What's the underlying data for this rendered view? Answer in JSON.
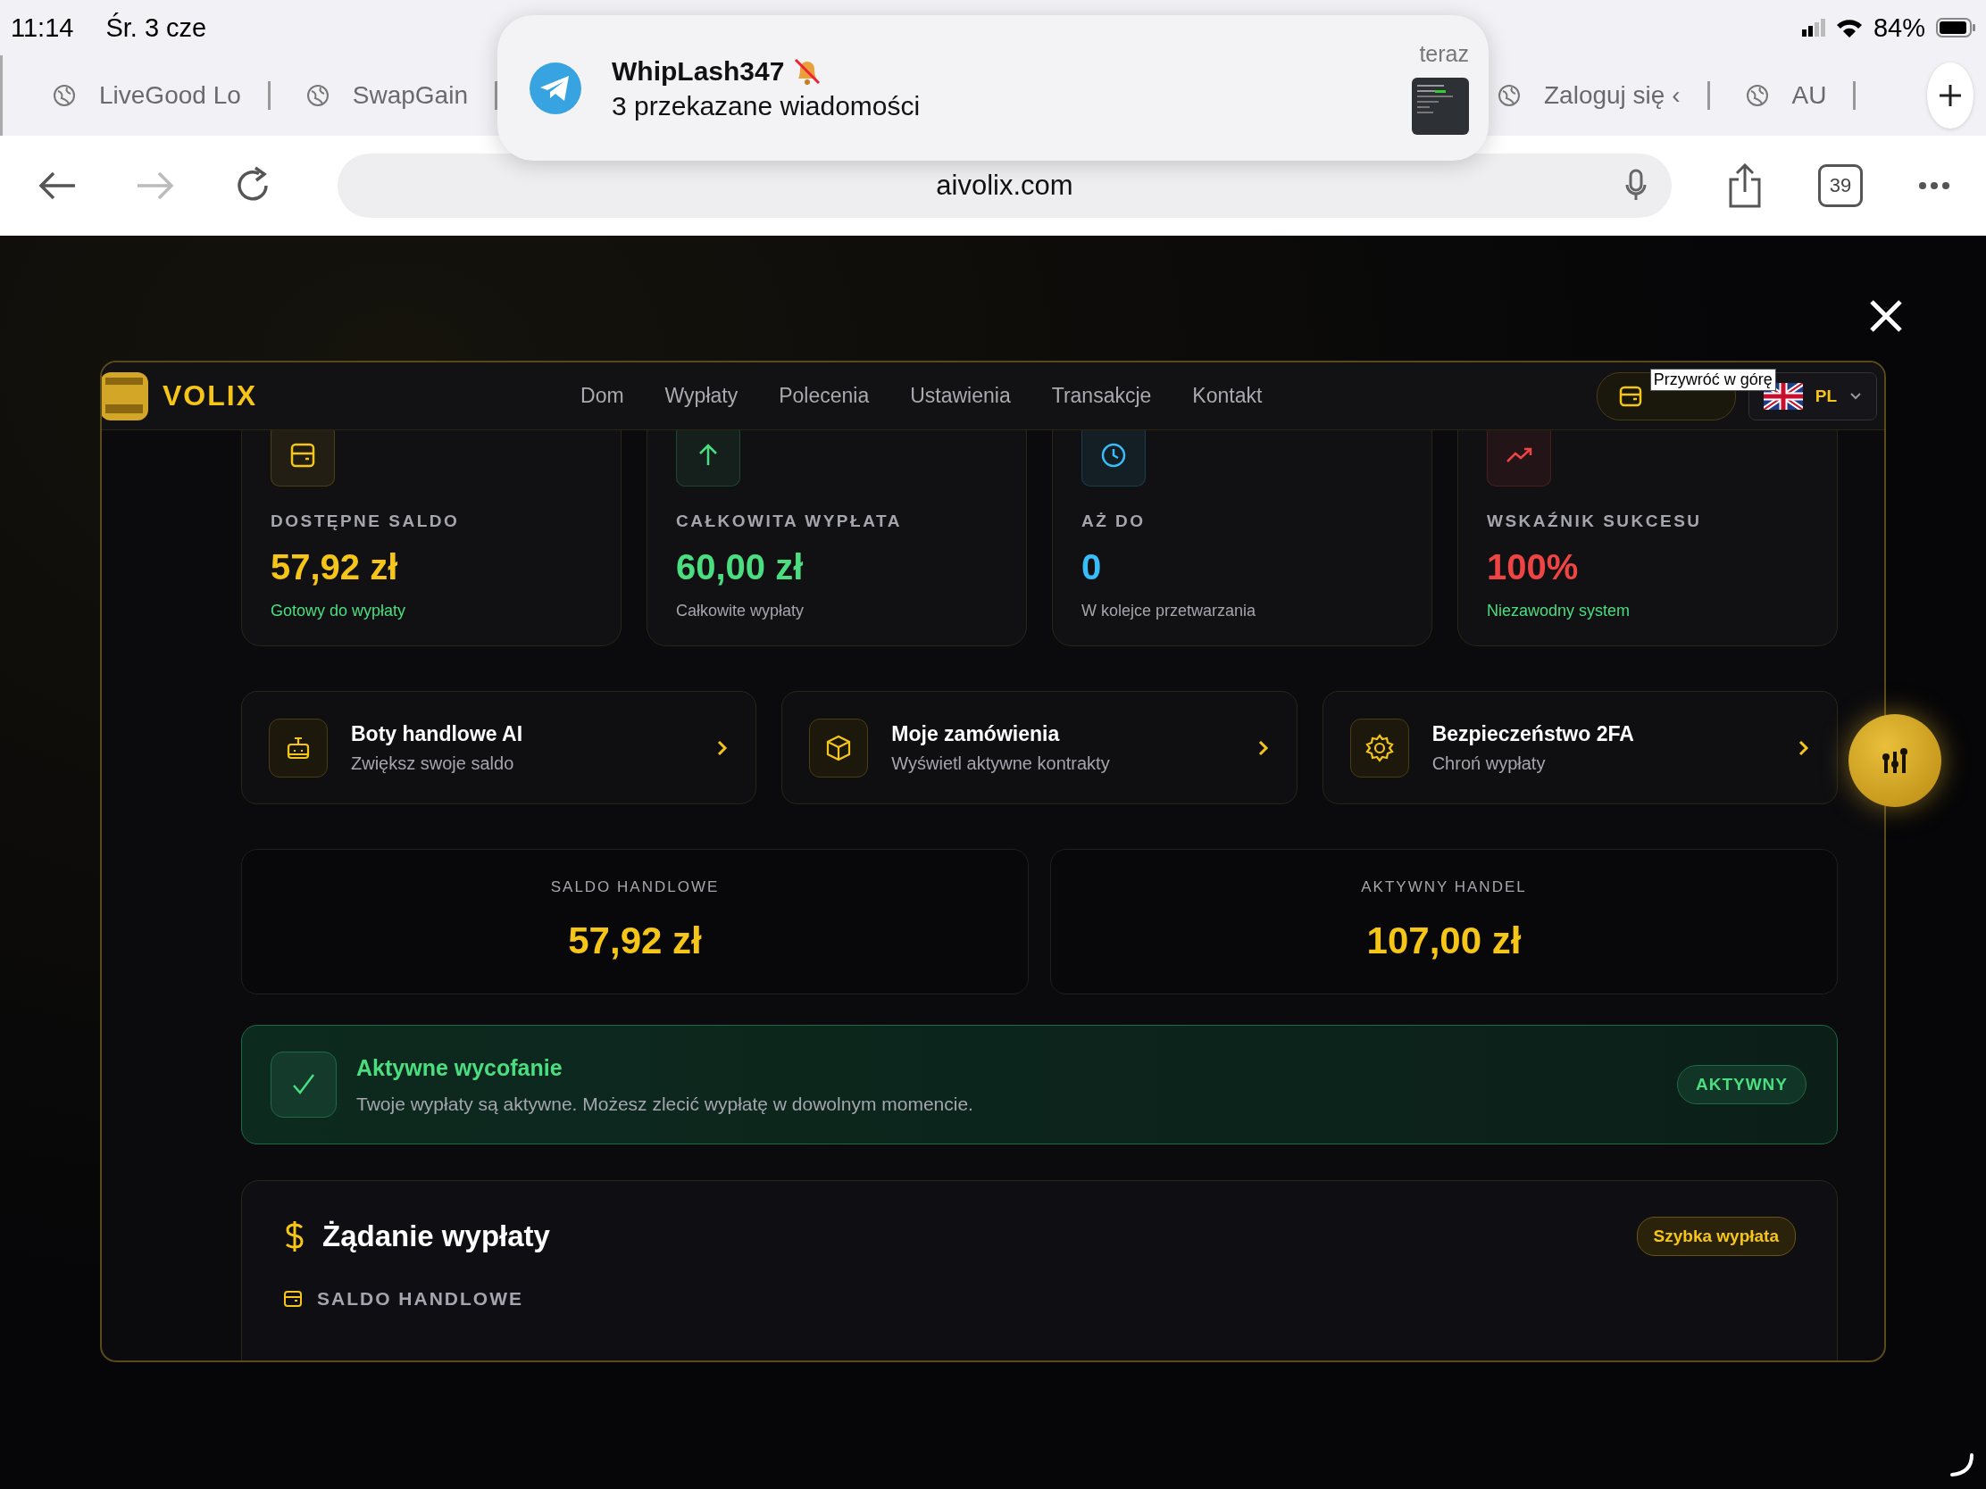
{
  "status_bar": {
    "time": "11:14",
    "date": "Śr. 3 cze",
    "battery": "84%"
  },
  "browser": {
    "tabs": [
      {
        "label": "LiveGood Lo"
      },
      {
        "label": "SwapGain"
      },
      {
        "label": "Zaloguj się ‹"
      },
      {
        "label": "AU"
      }
    ],
    "url": "aivolix.com",
    "tab_count": "39"
  },
  "notification": {
    "title": "WhipLash347",
    "message": "3 przekazane wiadomości",
    "time": "teraz"
  },
  "site": {
    "logo": "VOLIX",
    "nav": [
      "Dom",
      "Wypłaty",
      "Polecenia",
      "Ustawienia",
      "Transakcje",
      "Kontakt"
    ],
    "tooltip": "Przywróć w górę",
    "language": "PL"
  },
  "stats": [
    {
      "kind": "wallet",
      "label": "DOSTĘPNE SALDO",
      "value": "57,92 zł",
      "note": "Gotowy do wypłaty",
      "note_accent": true,
      "color": "#f5c518"
    },
    {
      "kind": "arrow",
      "label": "CAŁKOWITA WYPŁATA",
      "value": "60,00 zł",
      "note": "Całkowite wypłaty",
      "note_accent": false,
      "color": "#4ade80"
    },
    {
      "kind": "clock",
      "label": "AŻ DO",
      "value": "0",
      "note": "W kolejce przetwarzania",
      "note_accent": false,
      "color": "#38bdf8"
    },
    {
      "kind": "trend",
      "label": "WSKAŹNIK SUKCESU",
      "value": "100%",
      "note": "Niezawodny system",
      "note_accent": true,
      "color": "#ef4444"
    }
  ],
  "actions": [
    {
      "kind": "robot",
      "title": "Boty handlowe AI",
      "subtitle": "Zwiększ swoje saldo"
    },
    {
      "kind": "box",
      "title": "Moje zamówienia",
      "subtitle": "Wyświetl aktywne kontrakty"
    },
    {
      "kind": "gear",
      "title": "Bezpieczeństwo 2FA",
      "subtitle": "Chroń wypłaty"
    }
  ],
  "balances": [
    {
      "label": "SALDO HANDLOWE",
      "value": "57,92 zł"
    },
    {
      "label": "AKTYWNY HANDEL",
      "value": "107,00 zł"
    }
  ],
  "banner": {
    "title": "Aktywne wycofanie",
    "text": "Twoje wypłaty są aktywne. Możesz zlecić wypłatę w dowolnym momencie.",
    "badge": "AKTYWNY"
  },
  "request": {
    "title": "Żądanie wypłaty",
    "badge": "Szybka wypłata",
    "section_label": "SALDO HANDLOWE"
  }
}
